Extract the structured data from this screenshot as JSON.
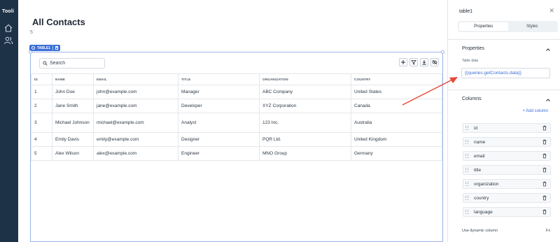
{
  "sidebar": {
    "logo": "Tooli",
    "icons": [
      "home-icon",
      "users-icon"
    ]
  },
  "page": {
    "title": "All Contacts",
    "count": "5"
  },
  "table_widget": {
    "label": "TABLE1",
    "search_placeholder": "Search",
    "tools": [
      "plus-icon",
      "filter-icon",
      "download-icon",
      "eye-off-icon"
    ],
    "columns": [
      "ID",
      "NAME",
      "EMAIL",
      "TITLE",
      "ORGANIZATION",
      "COUNTRY"
    ],
    "rows": [
      [
        "1",
        "John Doe",
        "john@example.com",
        "Manager",
        "ABC Company",
        "United States"
      ],
      [
        "2",
        "Jane Smith",
        "jane@example.com",
        "Developer",
        "XYZ Corporation",
        "Canada"
      ],
      [
        "3",
        "Michael Johnson",
        "michael@example.com",
        "Analyst",
        "123 Inc.",
        "Australia"
      ],
      [
        "4",
        "Emily Davis",
        "emily@example.com",
        "Designer",
        "PQR Ltd.",
        "United Kingdom"
      ],
      [
        "5",
        "Alex Wilson",
        "alex@example.com",
        "Engineer",
        "MNO Group",
        "Germany"
      ]
    ]
  },
  "panel": {
    "title": "table1",
    "tabs": [
      "Properties",
      "Styles"
    ],
    "active_tab": "Properties",
    "properties": {
      "title": "Properties",
      "table_data_label": "Table data",
      "table_data_value": "{{queries.getContacts.data}}"
    },
    "columns_section": {
      "title": "Columns",
      "add_label": "+ Add column",
      "items": [
        "id",
        "name",
        "email",
        "title",
        "organization",
        "country",
        "language"
      ]
    },
    "dynamic_column_label": "Use dynamic column",
    "fx_label": "Fx"
  },
  "colors": {
    "rail": "#1d3147",
    "accent": "#3b6fd8",
    "arrow": "#e8473a"
  }
}
